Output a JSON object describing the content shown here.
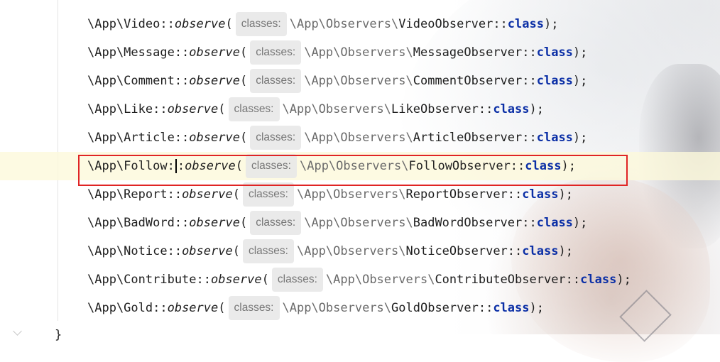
{
  "editor": {
    "hint_label": "classes:",
    "closing_brace": "}",
    "lines": [
      {
        "cls": "\\App\\Video::",
        "method": "observe",
        "paren": "(",
        "ns": "\\App\\Observers\\",
        "observer": "VideoObserver::",
        "kw": "class",
        "end": ");"
      },
      {
        "cls": "\\App\\Message::",
        "method": "observe",
        "paren": "(",
        "ns": "\\App\\Observers\\",
        "observer": "MessageObserver::",
        "kw": "class",
        "end": ");"
      },
      {
        "cls": "\\App\\Comment::",
        "method": "observe",
        "paren": "(",
        "ns": "\\App\\Observers\\",
        "observer": "CommentObserver::",
        "kw": "class",
        "end": ");"
      },
      {
        "cls": "\\App\\Like::",
        "method": "observe",
        "paren": "(",
        "ns": "\\App\\Observers\\",
        "observer": "LikeObserver::",
        "kw": "class",
        "end": ");"
      },
      {
        "cls": "\\App\\Article::",
        "method": "observe",
        "paren": "(",
        "ns": "\\App\\Observers\\",
        "observer": "ArticleObserver::",
        "kw": "class",
        "end": ");"
      },
      {
        "cls": "\\App\\Follow:",
        "cls_after_caret": ":",
        "method": "observe",
        "paren": "(",
        "ns": "\\App\\Observers\\",
        "observer": "FollowObserver::",
        "kw": "class",
        "end": ");"
      },
      {
        "cls": "\\App\\Report::",
        "method": "observe",
        "paren": "(",
        "ns": "\\App\\Observers\\",
        "observer": "ReportObserver::",
        "kw": "class",
        "end": ");"
      },
      {
        "cls": "\\App\\BadWord::",
        "method": "observe",
        "paren": "(",
        "ns": "\\App\\Observers\\",
        "observer": "BadWordObserver::",
        "kw": "class",
        "end": ");"
      },
      {
        "cls": "\\App\\Notice::",
        "method": "observe",
        "paren": "(",
        "ns": "\\App\\Observers\\",
        "observer": "NoticeObserver::",
        "kw": "class",
        "end": ");"
      },
      {
        "cls": "\\App\\Contribute::",
        "method": "observe",
        "paren": "(",
        "ns": "\\App\\Observers\\",
        "observer": "ContributeObserver::",
        "kw": "class",
        "end": ");"
      },
      {
        "cls": "\\App\\Gold::",
        "method": "observe",
        "paren": "(",
        "ns": "\\App\\Observers\\",
        "observer": "GoldObserver::",
        "kw": "class",
        "end": ");"
      }
    ]
  },
  "colors": {
    "keyword": "#0b2fa6",
    "highlight_border": "#e02424",
    "caret_line": "#fdf9db"
  }
}
